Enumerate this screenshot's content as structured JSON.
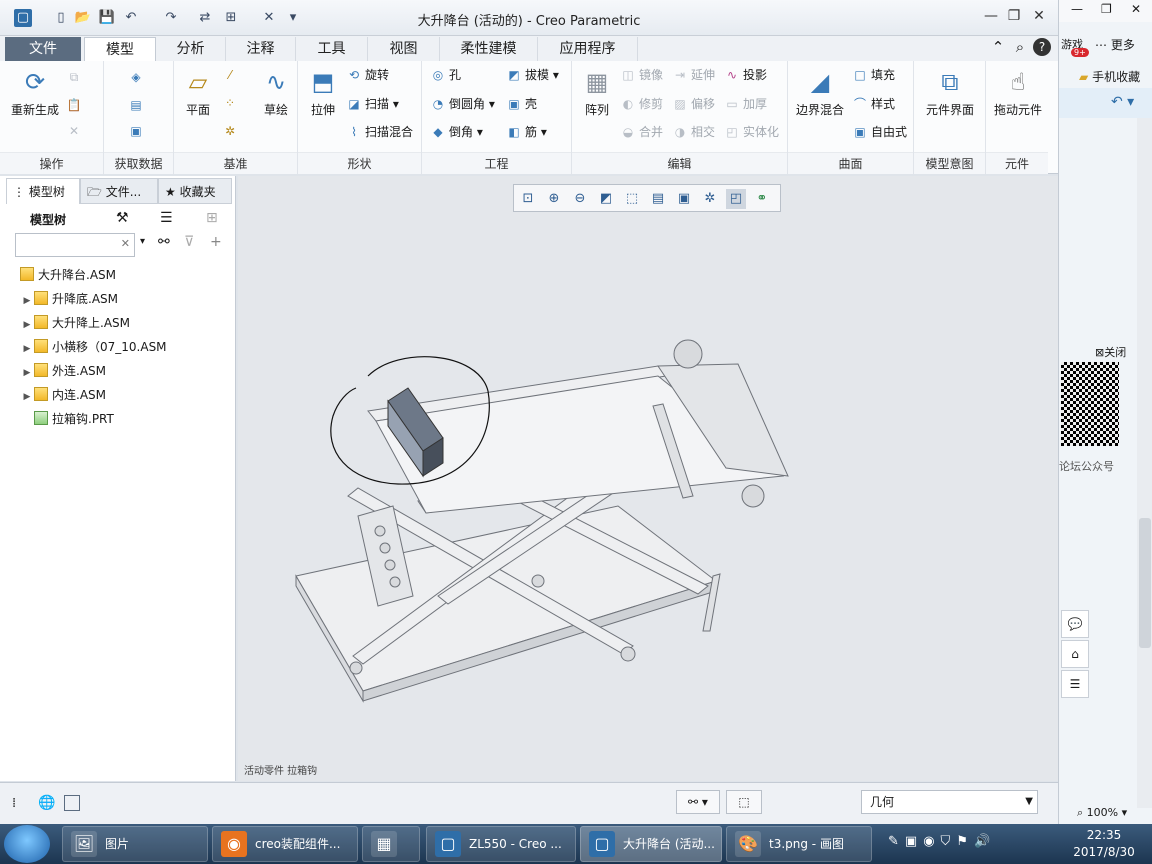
{
  "window": {
    "title": "大升降台 (活动的) - Creo Parametric",
    "minimize": "—",
    "maximize": "❐",
    "close": "✕"
  },
  "quick_access": [
    "▢",
    "📂",
    "💾",
    "↶",
    "↷",
    "⇄",
    "⊞",
    "✕",
    "▾"
  ],
  "tabs": [
    {
      "label": "文件"
    },
    {
      "label": "模型"
    },
    {
      "label": "分析"
    },
    {
      "label": "注释"
    },
    {
      "label": "工具"
    },
    {
      "label": "视图"
    },
    {
      "label": "柔性建模"
    },
    {
      "label": "应用程序"
    }
  ],
  "ribbon": {
    "operations": {
      "label": "操作",
      "regenerate": "重新生成"
    },
    "get_data": {
      "label": "获取数据"
    },
    "datum": {
      "label": "基准",
      "plane": "平面",
      "sketch": "草绘"
    },
    "shapes": {
      "label": "形状",
      "extrude": "拉伸",
      "revolve": "旋转",
      "sweep": "扫描",
      "swept_blend": "扫描混合"
    },
    "engineering": {
      "label": "工程",
      "hole": "孔",
      "round": "倒圆角",
      "chamfer": "倒角",
      "draft": "拔模",
      "shell": "壳",
      "rib": "筋"
    },
    "editing": {
      "label": "编辑",
      "pattern": "阵列",
      "mirror": "镜像",
      "extend": "延伸",
      "project": "投影",
      "trim": "修剪",
      "offset": "偏移",
      "thicken": "加厚",
      "merge": "合并",
      "intersect": "相交",
      "solidify": "实体化"
    },
    "surfaces": {
      "label": "曲面",
      "boundary_blend": "边界混合",
      "fill": "填充",
      "style": "样式",
      "freestyle": "自由式"
    },
    "model_intent": {
      "label": "模型意图",
      "component_interface": "元件界面"
    },
    "component": {
      "label": "元件",
      "drag_components": "拖动元件"
    }
  },
  "left_panel": {
    "tabs": [
      "模型树",
      "文件...",
      "收藏夹"
    ],
    "title": "模型树",
    "search_clear": "✕",
    "tree": [
      {
        "label": "大升降台.ASM",
        "type": "asm",
        "expandable": false,
        "indent": 0
      },
      {
        "label": "升降底.ASM",
        "type": "asm",
        "expandable": true,
        "indent": 1
      },
      {
        "label": "大升降上.ASM",
        "type": "asm",
        "expandable": true,
        "indent": 1
      },
      {
        "label": "小横移（07_10.ASM",
        "type": "asm",
        "expandable": true,
        "indent": 1
      },
      {
        "label": "外连.ASM",
        "type": "asm",
        "expandable": true,
        "indent": 1
      },
      {
        "label": "内连.ASM",
        "type": "asm",
        "expandable": true,
        "indent": 1
      },
      {
        "label": "拉箱钩.PRT",
        "type": "prt",
        "expandable": false,
        "indent": 1
      }
    ]
  },
  "graphics": {
    "status_message": "活动零件 拉箱钩"
  },
  "bottom_bar": {
    "filter_value": "几何"
  },
  "right_strip": {
    "games": "游戏",
    "badge": "9+",
    "more": "更多",
    "mobile_fav": "手机收藏",
    "close_ad": "⊠关闭",
    "forum": "论坛公众号",
    "zoom": "100%"
  },
  "taskbar": {
    "items": [
      {
        "label": "图片",
        "icon": "🖼"
      },
      {
        "label": "creo装配组件...",
        "icon": "◉"
      },
      {
        "label": "",
        "icon": "▦"
      },
      {
        "label": "ZL550 - Creo ...",
        "icon": "▢"
      },
      {
        "label": "大升降台 (活动...",
        "icon": "▢"
      },
      {
        "label": "t3.png - 画图",
        "icon": "🎨"
      }
    ],
    "time": "22:35",
    "date": "2017/8/30"
  }
}
